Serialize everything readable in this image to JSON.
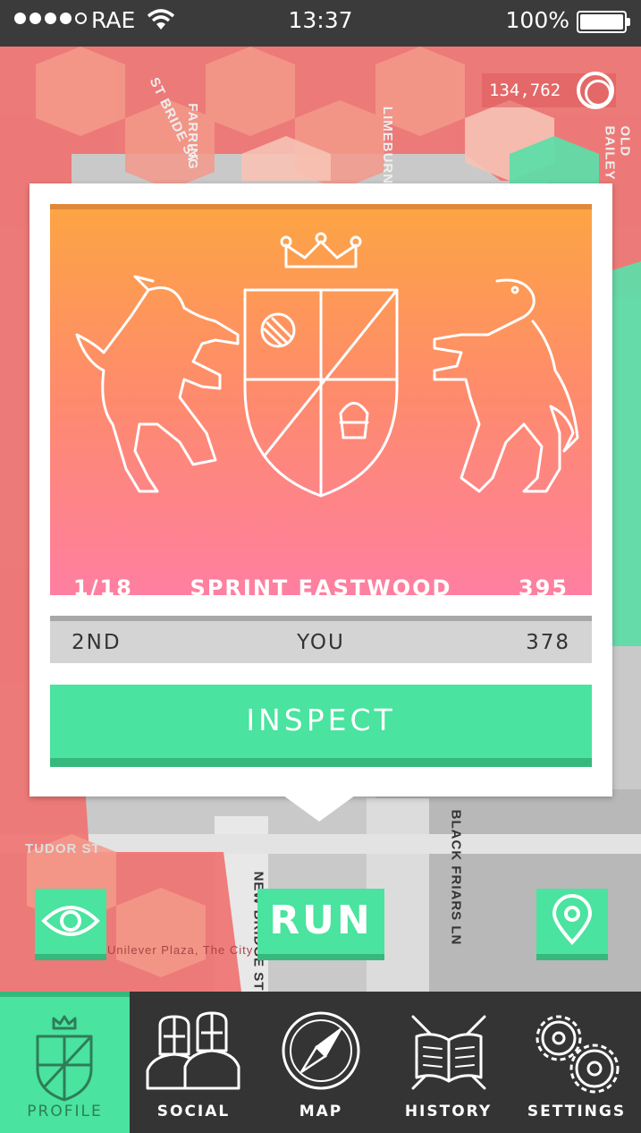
{
  "status_bar": {
    "carrier": "RAE",
    "time": "13:37",
    "battery": "100%",
    "signal_bars_filled": 4,
    "signal_bars_total": 5
  },
  "map": {
    "streets": [
      "ST BRIDE ST",
      "FARRING",
      "LIMEBURN",
      "OLD BAILEY",
      "TUDOR ST",
      "NEW BRIDGE ST",
      "BLACK FRIARS LN",
      "Unilever Plaza, The City"
    ],
    "territory_color": "#f0716f",
    "ally_color": "#4ae39f"
  },
  "score": {
    "value": "134,762",
    "icon": "coin-icon"
  },
  "card": {
    "rank": "1/18",
    "title": "SPRINT EASTWOOD",
    "points": "395",
    "crest_icon": "coat-of-arms-icon",
    "gradient_top": "#fda444",
    "gradient_bottom": "#ff7fa1",
    "you_row": {
      "position": "2ND",
      "label": "YOU",
      "points": "378"
    },
    "inspect_label": "INSPECT"
  },
  "actions": {
    "eye_icon": "eye-icon",
    "run_label": "RUN",
    "pin_icon": "map-pin-icon",
    "accent": "#4ae39f"
  },
  "tabs": [
    {
      "label": "PROFILE",
      "icon": "crest-icon",
      "active": true
    },
    {
      "label": "SOCIAL",
      "icon": "knights-icon",
      "active": false
    },
    {
      "label": "MAP",
      "icon": "compass-icon",
      "active": false
    },
    {
      "label": "HISTORY",
      "icon": "book-swords-icon",
      "active": false
    },
    {
      "label": "SETTINGS",
      "icon": "gears-icon",
      "active": false
    }
  ]
}
